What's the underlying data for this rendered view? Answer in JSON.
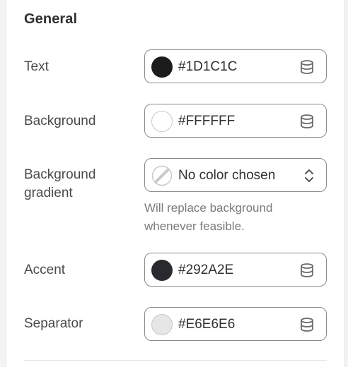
{
  "section": {
    "title": "General"
  },
  "rows": {
    "text": {
      "label": "Text",
      "value": "#1D1C1C",
      "swatch_color": "#1D1C1C",
      "icon": "database-icon"
    },
    "background": {
      "label": "Background",
      "value": "#FFFFFF",
      "swatch_color": "#FFFFFF",
      "icon": "database-icon"
    },
    "background_gradient": {
      "label": "Background gradient",
      "value": "No color chosen",
      "help": "Will replace background whenever feasible.",
      "icon": "chevron-up-down-icon"
    },
    "accent": {
      "label": "Accent",
      "value": "#292A2E",
      "swatch_color": "#292A2E",
      "icon": "database-icon"
    },
    "separator": {
      "label": "Separator",
      "value": "#E6E6E6",
      "swatch_color": "#E6E6E6",
      "icon": "database-icon"
    }
  }
}
